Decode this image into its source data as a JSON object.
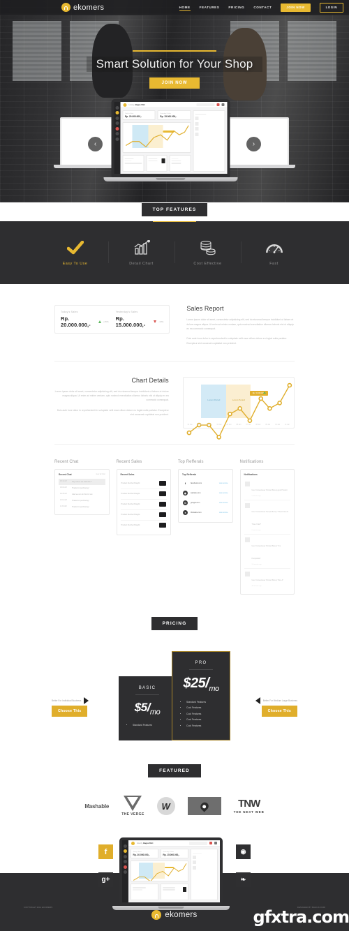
{
  "nav": {
    "brand": "ekomers",
    "brand_icon": "bag-icon",
    "links": [
      {
        "label": "HOME",
        "active": true
      },
      {
        "label": "FEATURES",
        "active": false
      },
      {
        "label": "PRICING",
        "active": false
      },
      {
        "label": "CONTACT",
        "active": false
      }
    ],
    "join_label": "JOIN NOW",
    "login_label": "LOGIN"
  },
  "hero": {
    "title": "Smart Solution for Your Shop",
    "cta": "JOIN NOW",
    "prev_icon": "chevron-left-icon",
    "next_icon": "chevron-right-icon"
  },
  "dashboard_mock": {
    "greeting_pre": "Howdy,",
    "greeting_name": "Bagus Fikri",
    "today_label": "Today's Sales",
    "today_value": "Rp. 20.000.000,-",
    "yesterday_label": "Yesterday's Sales",
    "yesterday_value": "Rp. 15.000.000,-"
  },
  "top_features": {
    "tag": "TOP FEATURES",
    "items": [
      {
        "label": "Easy To Use",
        "icon": "check-icon",
        "highlight": true
      },
      {
        "label": "Detail Chart",
        "icon": "bar-chart-icon",
        "highlight": false
      },
      {
        "label": "Cost Effective",
        "icon": "coins-icon",
        "highlight": false
      },
      {
        "label": "Fast",
        "icon": "speedometer-icon",
        "highlight": false
      }
    ]
  },
  "sales_report": {
    "today_label": "Today's Sales",
    "today_value": "Rp. 20.000.000,-",
    "today_delta": "+25%",
    "today_trend_icon": "triangle-up-icon",
    "yesterday_label": "Yesterday's Sales",
    "yesterday_value": "Rp. 15.000.000,-",
    "yesterday_delta": "-10%",
    "yesterday_trend_icon": "triangle-down-icon",
    "title": "Sales Report",
    "paragraph1": "Lorem ipsum dolor sit amet, consectetur adipisicing elit, sed do eiusmod tempor incididunt ut labore et dolore magna aliqua. Ut enim ad minim veniam, quis nostrud exercitation ullamco laboris nisi ut aliquip ex ea commodo consequat.",
    "paragraph2": "Duis aute irure dolor in reprehenderit in voluptate velit esse cillum dolore eu fugiat nulla pariatur. Excepteur sint occaecat cupidatat non proident."
  },
  "chart_details": {
    "title": "Chart Details",
    "paragraph1": "Lorem ipsum dolor sit amet, consectetur adipisicing elit, sed do eiusmod tempor incididunt ut labore et dolore magna aliqua. Ut enim ad minim veniam, quis nostrud exercitation ullamco laboris nisi ut aliquip ex ea commodo consequat.",
    "paragraph2": "Duis aute irure dolor in reprehenderit in voluptate velit esse cillum dolore eu fugiat nulla pariatur. Excepteur sint occaecat cupidatat non proident.",
    "band_blue_label": "Lorem Period",
    "band_yellow_label": "Lorem Period",
    "tooltip": "Rp. 5.000.000,-",
    "tooltip_trend_icon": "triangle-up-icon"
  },
  "chart_data": {
    "type": "line",
    "title": "Chart Details",
    "xlabel": "",
    "ylabel": "",
    "categories": [
      "01 Jan",
      "02 Jan",
      "03 Jan",
      "04 Jan",
      "05 Jan",
      "06 Jan",
      "07 Jan",
      "08 Jan",
      "09 Jan",
      "10 Jan",
      "11 Jan"
    ],
    "series": [
      {
        "name": "Sales",
        "values": [
          10,
          22,
          22,
          6,
          40,
          47,
          34,
          62,
          52,
          60,
          86
        ]
      }
    ],
    "ylim": [
      0,
      100
    ],
    "grid": false,
    "legend": "none",
    "bands": [
      {
        "label": "Lorem Period",
        "color": "#d3eaf6",
        "from": "02 Jan",
        "to": "04 Jan"
      },
      {
        "label": "Lorem Period",
        "color": "#fbeed1",
        "from": "04 Jan",
        "to": "06 Jan"
      }
    ],
    "annotation": {
      "text": "Rp. 5.000.000,-",
      "at": "08 Jan"
    },
    "line_color": "#e0ae2b"
  },
  "panels": {
    "recent_chat": {
      "title": "Recent Chat",
      "box_title": "Recent Chat",
      "box_action": "view all chat",
      "rows": [
        {
          "time": "08:44 AM",
          "msg": "Hey, how is our stuff now ?",
          "highlight": true
        },
        {
          "time": "09:02 AM",
          "msg": "Thanks for purchasing !",
          "highlight": false
        },
        {
          "time": "09:45 AM",
          "msg": "Glad we can do this for now",
          "highlight": false
        },
        {
          "time": "10:12 AM",
          "msg": "Thanks for purchasing !",
          "highlight": false
        },
        {
          "time": "11:30 AM",
          "msg": "Thanks for purchasing !",
          "highlight": false
        }
      ]
    },
    "recent_sales": {
      "title": "Recent Sales",
      "box_title": "Recent Sales",
      "rows": [
        {
          "text": "Product Number Bought",
          "action_icon": "cart-icon"
        },
        {
          "text": "Product Number Bought",
          "action_icon": "cart-icon"
        },
        {
          "text": "Product Number Bought",
          "action_icon": "cart-icon"
        },
        {
          "text": "Product Number Bought",
          "action_icon": "cart-icon"
        },
        {
          "text": "Product Number Bought",
          "action_icon": "cart-icon"
        }
      ]
    },
    "top_refferals": {
      "title": "Top Refferals",
      "box_title": "Top Refferals",
      "rows": [
        {
          "name": "facebook.com",
          "icon": "facebook-icon",
          "link": "view source"
        },
        {
          "name": "website.com",
          "icon": "globe-icon",
          "link": "view source"
        },
        {
          "name": "google.com",
          "icon": "google-icon",
          "link": "view source"
        },
        {
          "name": "thisisdev.com",
          "icon": "dribbble-icon",
          "link": "view source"
        }
      ]
    },
    "notifications": {
      "title": "Notifications",
      "box_title": "Notifications",
      "rows": [
        {
          "text": "User Consectetuer Product Bucup good Product",
          "time": "2 minutes ago"
        },
        {
          "text": "User Consectetuer Tempor Bucup \"I Recommend This of Stuff\"",
          "time": "9 minutes ago"
        },
        {
          "text": "User Consectetuer Product Bucup \"It is Perspiciatis\"",
          "time": "24 minutes ago"
        },
        {
          "text": "User Consectetuer Product Bucup \"Nice A\"",
          "time": "40 minutes ago"
        }
      ]
    }
  },
  "pricing": {
    "tag": "PRICING",
    "left_note": "Better For Individual Business",
    "right_note": "Better For Medium Large Business",
    "left_button": "Choose This",
    "right_button": "Choose This",
    "basic": {
      "name": "BASIC",
      "price": "$5/",
      "period": "mo",
      "features": [
        "Standard Features"
      ]
    },
    "pro": {
      "name": "PRO",
      "price": "$25/",
      "period": "mo",
      "features": [
        "Standard Features",
        "Cool Features",
        "Cool Features",
        "Cool Features",
        "Cool Features"
      ]
    }
  },
  "featured": {
    "tag": "FEATURED",
    "logos": [
      {
        "name": "Mashable",
        "icon": "mashable-logo"
      },
      {
        "name": "THE VERGE",
        "icon": "the-verge-logo"
      },
      {
        "name": "W",
        "icon": "wired-logo"
      },
      {
        "name": "",
        "icon": "dark-box-logo"
      },
      {
        "name": "TNW",
        "sub": "THE NEXT WEB",
        "icon": "tnw-logo"
      }
    ]
  },
  "footer": {
    "social": [
      {
        "name": "facebook",
        "glyph": "f",
        "icon": "facebook-icon"
      },
      {
        "name": "googleplus",
        "glyph": "g+",
        "icon": "google-plus-icon"
      },
      {
        "name": "instagram",
        "glyph": "◉",
        "icon": "instagram-icon"
      },
      {
        "name": "twitter",
        "glyph": "❧",
        "icon": "twitter-icon"
      }
    ],
    "brand": "ekomers",
    "copyright": "COPYRIGHT 2014 EKOMERS",
    "credit": "DESIGNED BY BAGUS FIKRI",
    "watermark": "gfxtra.com"
  }
}
